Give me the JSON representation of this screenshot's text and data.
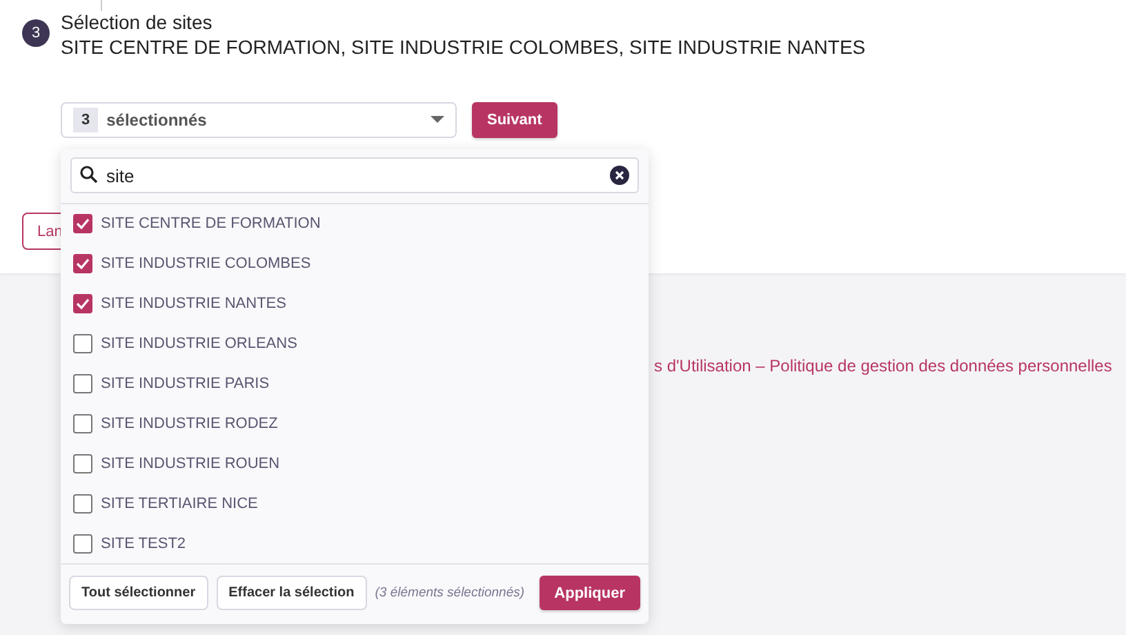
{
  "step": {
    "number": "3",
    "title": "Sélection de sites",
    "summary": "SITE CENTRE DE FORMATION, SITE INDUSTRIE COLOMBES, SITE INDUSTRIE NANTES"
  },
  "dropdown": {
    "count": "3",
    "label": "sélectionnés",
    "expanded": true
  },
  "next_button": "Suivant",
  "hidden_button": "Lan",
  "footer_link": "s d'Utilisation – Politique de gestion des données personnelles",
  "popup": {
    "search": {
      "value": "site"
    },
    "options": [
      {
        "label": "SITE CENTRE DE FORMATION",
        "checked": true
      },
      {
        "label": "SITE INDUSTRIE COLOMBES",
        "checked": true
      },
      {
        "label": "SITE INDUSTRIE NANTES",
        "checked": true
      },
      {
        "label": "SITE INDUSTRIE ORLEANS",
        "checked": false
      },
      {
        "label": "SITE INDUSTRIE PARIS",
        "checked": false
      },
      {
        "label": "SITE INDUSTRIE RODEZ",
        "checked": false
      },
      {
        "label": "SITE INDUSTRIE ROUEN",
        "checked": false
      },
      {
        "label": "SITE TERTIAIRE NICE",
        "checked": false
      },
      {
        "label": "SITE TEST2",
        "checked": false
      }
    ],
    "select_all": "Tout sélectionner",
    "clear": "Effacer la sélection",
    "status": "(3 éléments sélectionnés)",
    "apply": "Appliquer"
  }
}
